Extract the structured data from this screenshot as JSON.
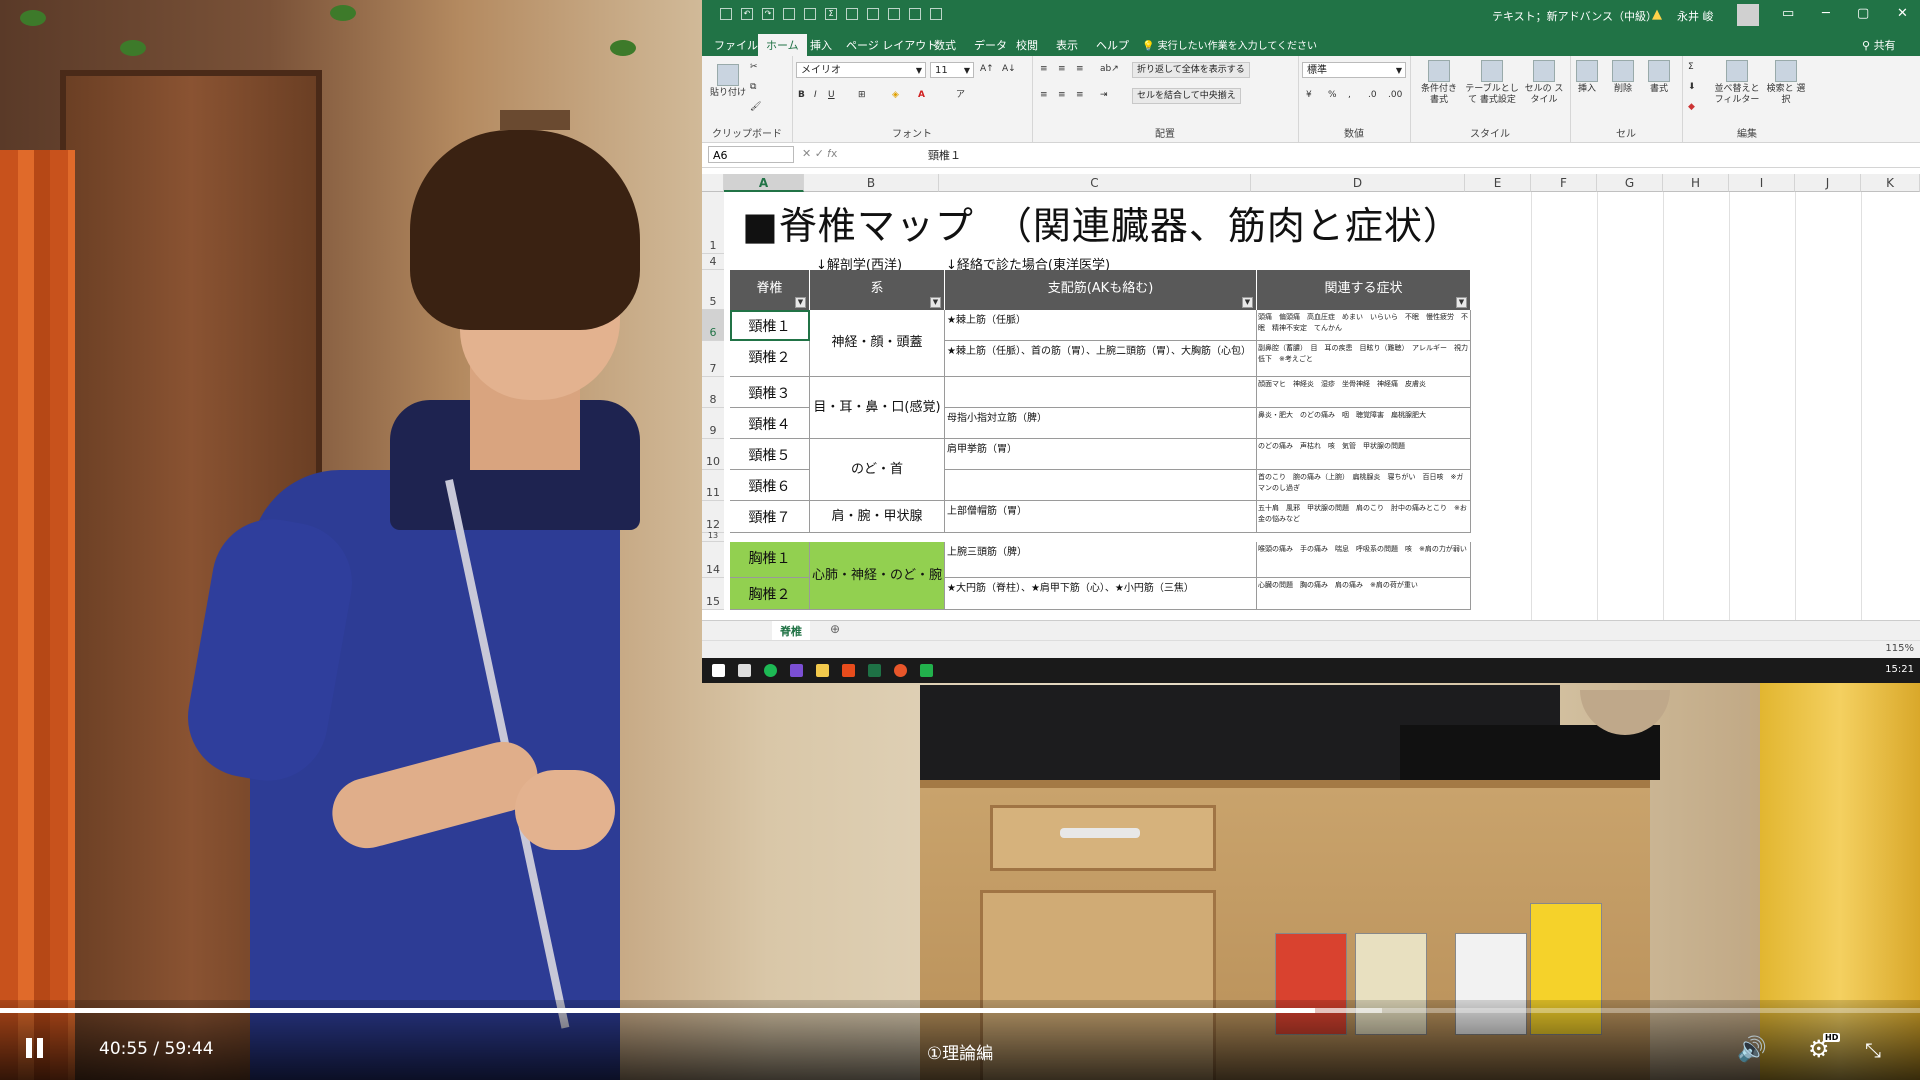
{
  "excel": {
    "title_bar": {
      "document": "テキスト；新アドバンス（中級）",
      "user": "永井 峻",
      "buttons": [
        "─",
        "▢",
        "✕"
      ]
    },
    "menu_tabs": [
      "ファイル",
      "ホーム",
      "挿入",
      "ページ レイアウト",
      "数式",
      "データ",
      "校閲",
      "表示",
      "ヘルプ"
    ],
    "active_tab": "ホーム",
    "tell_me": "実行したい作業を入力してください",
    "share": "共有",
    "ribbon": {
      "clipboard": {
        "label": "クリップボード",
        "paste": "貼り付け"
      },
      "font": {
        "label": "フォント",
        "name": "メイリオ",
        "size": "11"
      },
      "alignment": {
        "label": "配置",
        "wrap": "折り返して全体を表示する",
        "merge": "セルを結合して中央揃え"
      },
      "number": {
        "label": "数値",
        "format": "標準"
      },
      "styles": {
        "label": "スタイル",
        "conditional": "条件付き 書式",
        "table": "テーブルとして 書式設定",
        "cell_styles": "セルの スタイル"
      },
      "cells": {
        "label": "セル",
        "insert": "挿入",
        "delete": "削除",
        "format": "書式"
      },
      "editing": {
        "label": "編集",
        "sort": "並べ替えと フィルター",
        "find": "検索と 選択"
      }
    },
    "name_box": "A6",
    "formula_value": "頸椎１",
    "columns": [
      "A",
      "B",
      "C",
      "D",
      "E",
      "F",
      "G",
      "H",
      "I",
      "J",
      "K"
    ],
    "rows": [
      "1",
      "4",
      "5",
      "6",
      "7",
      "8",
      "9",
      "10",
      "11",
      "12",
      "13",
      "14",
      "15"
    ],
    "sheet": {
      "title": "■脊椎マップ　（関連臓器、筋肉と症状）",
      "note_b": "↓解剖学(西洋)",
      "note_c": "↓経絡で診た場合(東洋医学)",
      "headers": [
        "脊椎",
        "系",
        "支配筋(AKも絡む)",
        "関連する症状"
      ],
      "spines": [
        "頸椎１",
        "頸椎２",
        "頸椎３",
        "頸椎４",
        "頸椎５",
        "頸椎６",
        "頸椎７",
        "胸椎１",
        "胸椎２"
      ],
      "systems": [
        "神経・顔・頭蓋",
        "目・耳・鼻・口(感覚)",
        "のど・首",
        "肩・腕・甲状腺",
        "心肺・神経・のど・腕"
      ],
      "muscles": [
        "★棘上筋（任脈）",
        "★棘上筋（任脈）、首の筋（胃）、上腕二頭筋（胃）、大胸筋（心包）",
        "",
        "母指小指対立筋（脾）",
        "肩甲挙筋（胃）",
        "",
        "上部僧帽筋（胃）",
        "上腕三頭筋（脾）",
        "★大円筋（脊柱）、★肩甲下筋（心）、★小円筋（三焦）"
      ],
      "symptoms": [
        "頭痛　偏頭痛　高血圧症　めまい　いらいら　不眠　慢性疲労　不眠　精神不安定　てんかん",
        "副鼻腔（蓄膿）　目　耳の疾患　目眩り（難聴）　アレルギー　視力低下　※考えごと",
        "顔面マヒ　神経炎　湿疹　坐骨神経　神経痛　皮膚炎",
        "鼻炎・肥大　のどの痛み　咽　聴覚障害　扁桃腺肥大",
        "のどの痛み　声枯れ　咳　気管　甲状腺の問題",
        "首のこり　腕の痛み（上腕）　扁桃腺炎　寝ちがい　百日咳　※ガマンのし過ぎ",
        "五十肩　風邪　甲状腺の問題　肩のこり　肘中の痛みとこり　※お金の悩みなど",
        "喉頭の痛み　手の痛み　喘息　呼吸系の問題　咳　※肩の力が弱い",
        "心臓の問題　胸の痛み　肩の痛み　※肩の荷が重い"
      ]
    },
    "sheet_tab": "脊椎",
    "zoom": "115%",
    "clock": "15:21"
  },
  "player": {
    "time": "40:55 / 59:44",
    "title": "①理論編",
    "progress": 0.685,
    "buffered": 0.72
  },
  "colors": {
    "excel_green": "#217346",
    "header_gray": "#595959",
    "spine_green": "#92d050"
  },
  "icons": [
    "pause-icon",
    "volume-icon",
    "settings-icon",
    "hd-badge",
    "exit-fullscreen-icon"
  ]
}
